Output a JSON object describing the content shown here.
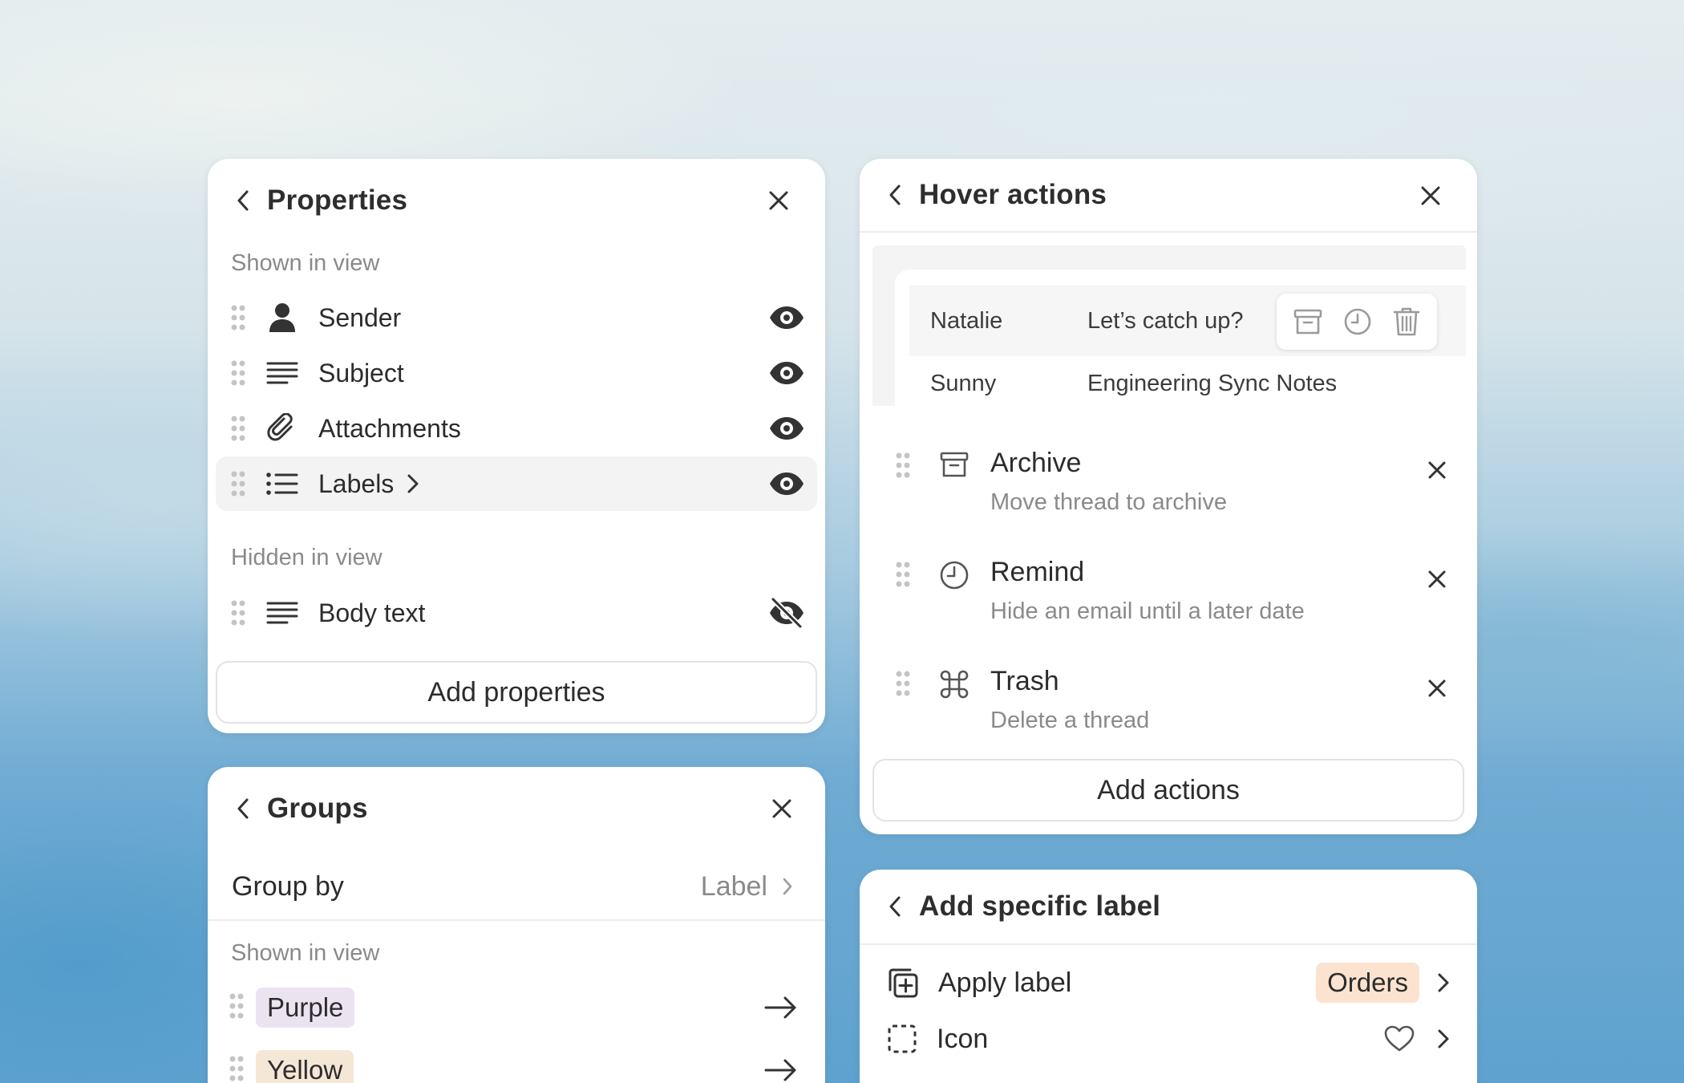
{
  "properties": {
    "title": "Properties",
    "shown_label": "Shown in view",
    "hidden_label": "Hidden in view",
    "shown": [
      {
        "label": "Sender",
        "icon": "person-icon"
      },
      {
        "label": "Subject",
        "icon": "text-lines-icon"
      },
      {
        "label": "Attachments",
        "icon": "paperclip-icon"
      },
      {
        "label": "Labels",
        "icon": "list-icon"
      }
    ],
    "hidden": [
      {
        "label": "Body text",
        "icon": "text-lines-icon"
      }
    ],
    "add_button": "Add properties"
  },
  "hover_actions": {
    "title": "Hover actions",
    "preview": [
      {
        "sender": "Natalie",
        "subject": "Let’s catch up?"
      },
      {
        "sender": "Sunny",
        "subject": "Engineering Sync Notes"
      }
    ],
    "actions": [
      {
        "name": "Archive",
        "description": "Move thread to archive",
        "icon": "archive-icon"
      },
      {
        "name": "Remind",
        "description": "Hide an email until a later date",
        "icon": "clock-icon"
      },
      {
        "name": "Trash",
        "description": "Delete a thread",
        "icon": "command-icon"
      }
    ],
    "add_button": "Add actions"
  },
  "groups": {
    "title": "Groups",
    "group_by_label": "Group by",
    "group_by_value": "Label",
    "shown_label": "Shown in view",
    "items": [
      {
        "label": "Purple",
        "color": "#ece3f1"
      },
      {
        "label": "Yellow",
        "color": "#f5e7d6"
      }
    ]
  },
  "add_label": {
    "title": "Add specific label",
    "apply_label": "Apply label",
    "apply_value": "Orders",
    "apply_value_color": "#fbe3d0",
    "icon_label": "Icon",
    "icon_value": "heart-icon"
  }
}
